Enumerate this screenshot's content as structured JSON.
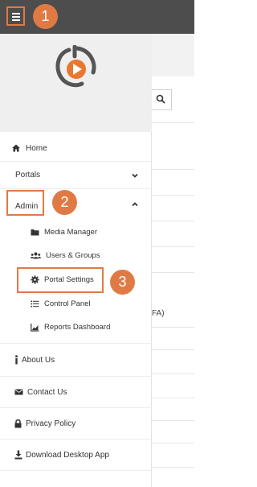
{
  "callouts": [
    "1",
    "2",
    "3"
  ],
  "menu": {
    "home": "Home",
    "portals": "Portals",
    "admin": "Admin",
    "admin_items": [
      "Media Manager",
      "Users & Groups",
      "Portal Settings",
      "Control Panel",
      "Reports Dashboard"
    ],
    "about": "About Us",
    "contact": "Contact Us",
    "privacy": "Privacy Policy",
    "download": "Download Desktop App"
  },
  "background": {
    "partial_text": "FA)"
  },
  "colors": {
    "topbar": "#4d4d4d",
    "callout": "#e07a45",
    "logo_orange": "#e8782f",
    "logo_gray": "#555555"
  },
  "icons": [
    "hamburger-icon",
    "logo-icon",
    "home-icon",
    "chevron-down-icon",
    "chevron-up-icon",
    "folder-icon",
    "users-icon",
    "gear-icon",
    "list-icon",
    "chart-icon",
    "info-icon",
    "envelope-icon",
    "lock-icon",
    "download-icon",
    "search-icon"
  ]
}
